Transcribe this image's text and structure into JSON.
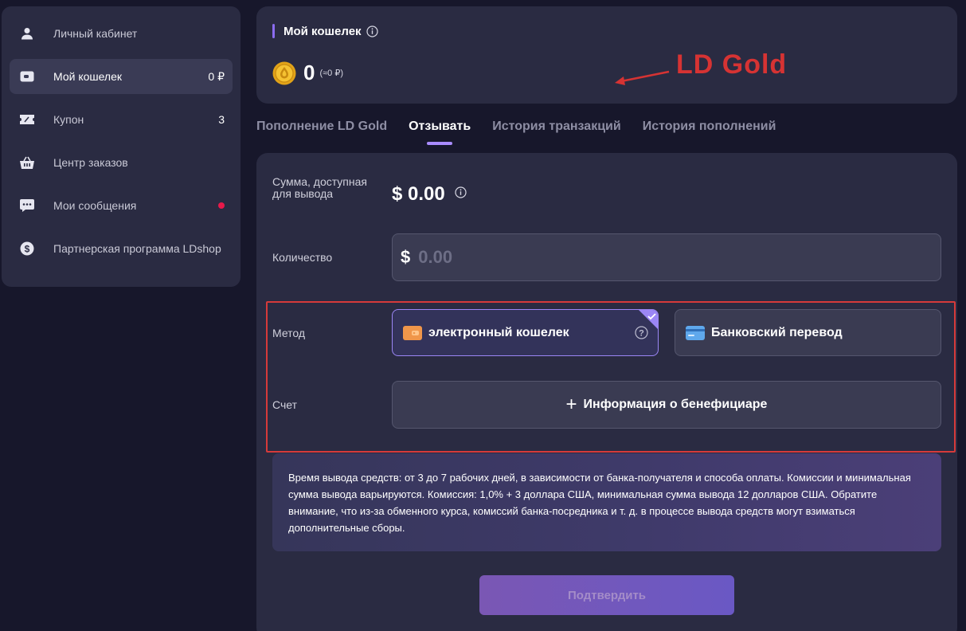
{
  "sidebar": {
    "items": [
      {
        "label": "Личный кабинет",
        "count": ""
      },
      {
        "label": "Мой кошелек",
        "count": "0 ₽"
      },
      {
        "label": "Купон",
        "count": "3"
      },
      {
        "label": "Центр заказов",
        "count": ""
      },
      {
        "label": "Мои сообщения",
        "count": ""
      },
      {
        "label": "Партнерская программа LDshop",
        "count": ""
      }
    ]
  },
  "wallet": {
    "title": "Мой кошелек",
    "balance": "0",
    "balance_rub": "(≈0 ₽)",
    "annotation": "LD Gold"
  },
  "tabs": [
    "Пополнение LD Gold",
    "Отзывать",
    "История транзакций",
    "История пополнений"
  ],
  "form": {
    "available_label": "Сумма, доступная для вывода",
    "available_value": "$ 0.00",
    "amount_label": "Количество",
    "currency_symbol": "$",
    "amount_placeholder": "0.00",
    "method_label": "Метод",
    "method_ewallet": "электронный кошелек",
    "method_bank": "Банковский перевод",
    "account_label": "Счет",
    "beneficiary_label": "Информация о бенефициаре",
    "notice": "Время вывода средств: от 3 до 7 рабочих дней, в зависимости от банка-получателя и способа оплаты. Комиссии и минимальная сумма вывода варьируются. Комиссия: 1,0% + 3 доллара США, минимальная сумма вывода 12 долларов США. Обратите внимание, что из-за обменного курса, комиссий банка-посредника и т. д. в процессе вывода средств могут взиматься дополнительные сборы.",
    "confirm_label": "Подтвердить"
  },
  "colors": {
    "accent": "#8b6cf0",
    "annotation_red": "#d63333",
    "notification_dot": "#e8194a"
  }
}
